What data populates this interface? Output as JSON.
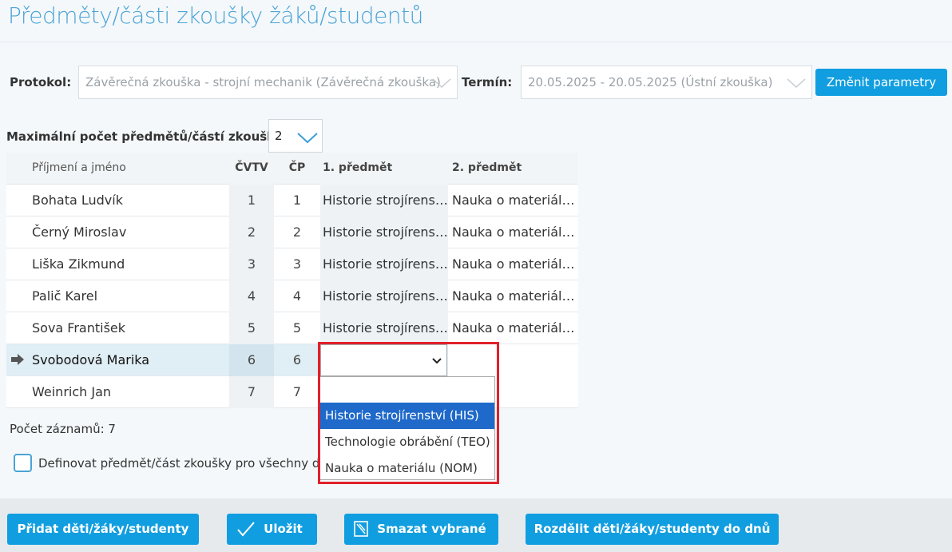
{
  "page_title": "Předměty/části zkoušky žáků/studentů",
  "filters": {
    "protocol_label": "Protokol:",
    "protocol_value": "Závěrečná zkouška - strojní mechanik (Závěrečná zkouška)",
    "term_label": "Termín:",
    "term_value": "20.05.2025 - 20.05.2025 (Ústní zkouška)",
    "change_button": "Změnit parametry",
    "max_label": "Maximální počet předmětů/částí zkoušky:",
    "max_value": "2"
  },
  "table": {
    "headers": {
      "name": "Příjmení a jméno",
      "cvtv": "ČVTV",
      "cp": "ČP",
      "p1": "1. předmět",
      "p2": "2. předmět"
    },
    "rows": [
      {
        "name": "Bohata Ludvík",
        "cvtv": "1",
        "cp": "1",
        "p1": "Historie strojírenství (HIS)",
        "p2": "Nauka o materiálu (NOM)"
      },
      {
        "name": "Černý Miroslav",
        "cvtv": "2",
        "cp": "2",
        "p1": "Historie strojírenství (HIS)",
        "p2": "Nauka o materiálu (NOM)"
      },
      {
        "name": "Liška Zikmund",
        "cvtv": "3",
        "cp": "3",
        "p1": "Historie strojírenství (HIS)",
        "p2": "Nauka o materiálu (NOM)"
      },
      {
        "name": "Palič Karel",
        "cvtv": "4",
        "cp": "4",
        "p1": "Historie strojírenství (HIS)",
        "p2": "Nauka o materiálu (NOM)"
      },
      {
        "name": "Sova František",
        "cvtv": "5",
        "cp": "5",
        "p1": "Historie strojírenství (HIS)",
        "p2": "Nauka o materiálu (NOM)"
      },
      {
        "name": "Svobodová Marika",
        "cvtv": "6",
        "cp": "6",
        "p1": "",
        "p2": ""
      },
      {
        "name": "Weinrich Jan",
        "cvtv": "7",
        "cp": "7",
        "p1": "",
        "p2": ""
      }
    ]
  },
  "dropdown": {
    "options": [
      "",
      "Historie strojírenství (HIS)",
      "Technologie obrábění (TEO)",
      "Nauka o materiálu (NOM)"
    ],
    "highlighted": "Historie strojírenství (HIS)"
  },
  "record_count": "Počet záznamů: 7",
  "define_all_label": "Definovat předmět/část zkoušky pro všechny děti/žáky/studenty",
  "footer": {
    "add": "Přidat děti/žáky/studenty",
    "save": "Uložit",
    "delete": "Smazat vybrané",
    "split": "Rozdělit děti/žáky/studenty do dnů"
  },
  "colors": {
    "accent": "#119ee0",
    "title": "#4aa3d6",
    "highlight": "#1e69c9",
    "frame": "#e0202a"
  }
}
